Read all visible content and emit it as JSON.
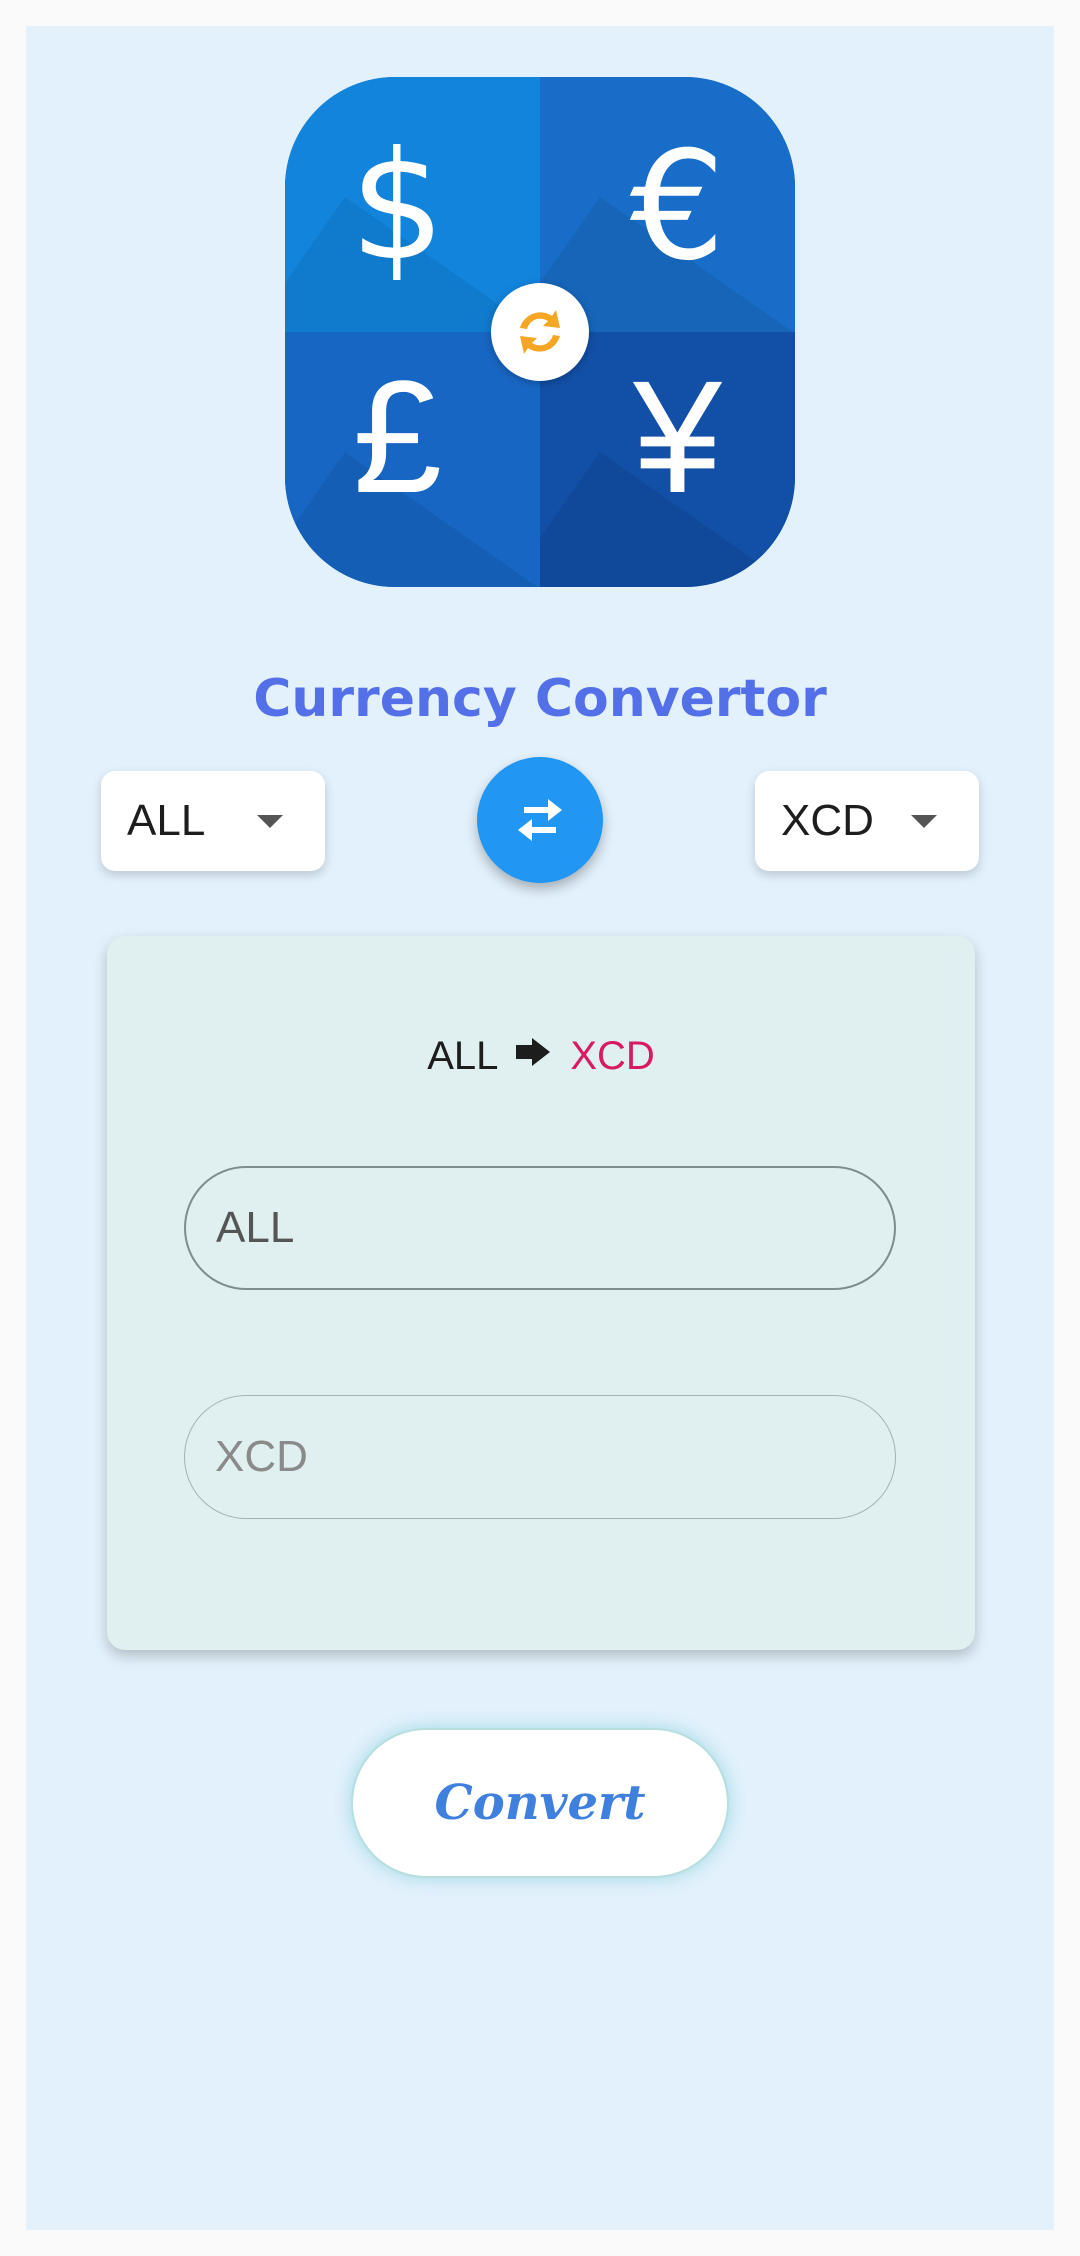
{
  "logo": {
    "symbols": [
      "$",
      "€",
      "£",
      "¥"
    ],
    "center_icon": "refresh-arrows-icon",
    "colors": {
      "tl": "#1284dc",
      "tr": "#186dc8",
      "bl": "#1766c3",
      "br": "#124fa6",
      "center_arrows": "#f5a623"
    }
  },
  "title": "Currency Convertor",
  "from_currency": {
    "value": "ALL"
  },
  "to_currency": {
    "value": "XCD"
  },
  "swap_icon": "swap-horizontal-icon",
  "card": {
    "pair_from": "ALL",
    "pair_to": "XCD",
    "input_from_placeholder": "ALL",
    "input_to_placeholder": "XCD"
  },
  "convert_label": "Convert",
  "colors": {
    "title": "#5470e8",
    "swap_button": "#2196f3",
    "pair_to": "#d81b60",
    "convert_text": "#3f7fdd",
    "background": "#e3f1fc",
    "card": "#e0f0f0"
  }
}
